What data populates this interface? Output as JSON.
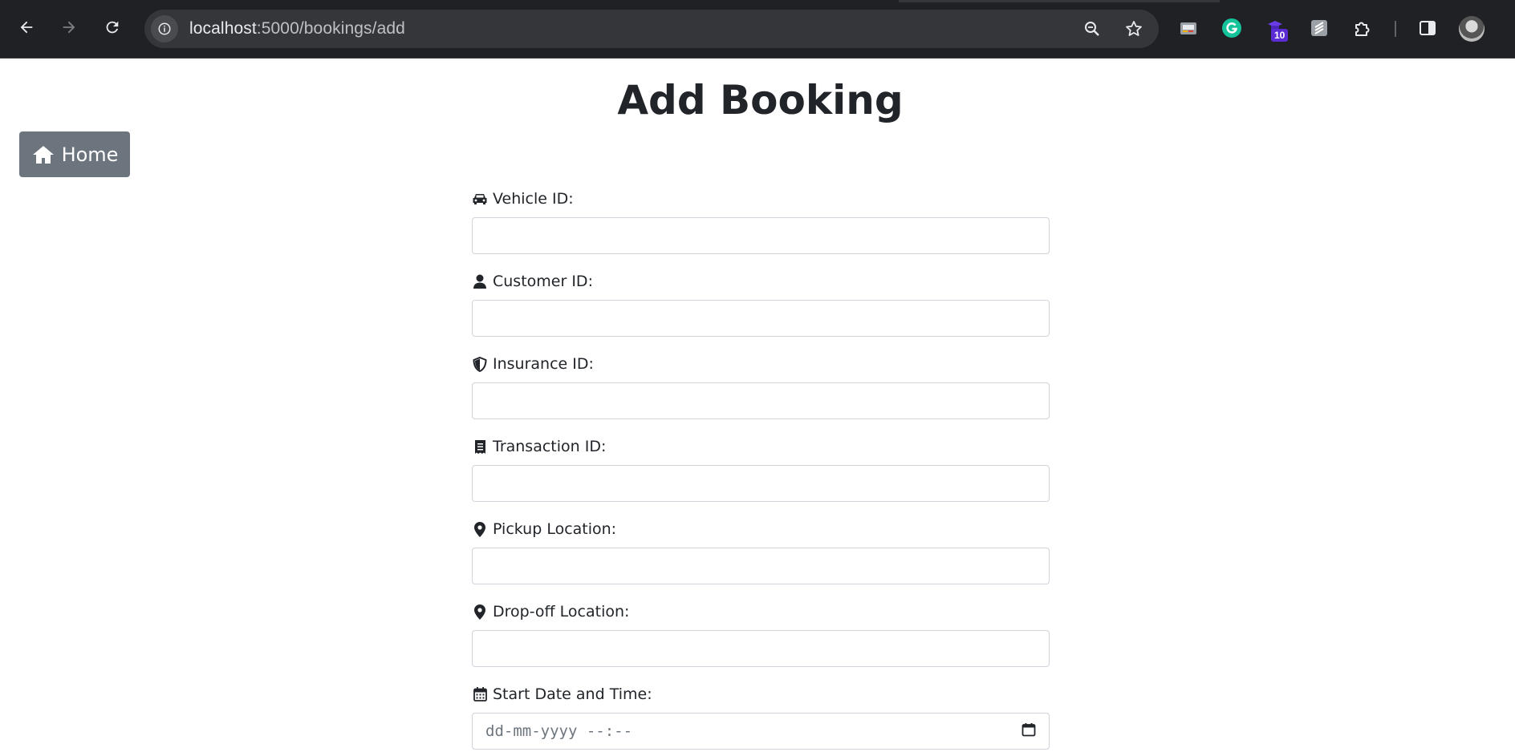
{
  "browser": {
    "url_host": "localhost",
    "url_path": ":5000/bookings/add",
    "extension_badge": "10"
  },
  "page": {
    "title": "Add Booking",
    "home_button": "Home"
  },
  "form": {
    "fields": [
      {
        "label": "Vehicle ID:",
        "icon": "car-icon",
        "value": ""
      },
      {
        "label": "Customer ID:",
        "icon": "user-icon",
        "value": ""
      },
      {
        "label": "Insurance ID:",
        "icon": "shield-icon",
        "value": ""
      },
      {
        "label": "Transaction ID:",
        "icon": "receipt-icon",
        "value": ""
      },
      {
        "label": "Pickup Location:",
        "icon": "map-marker-icon",
        "value": ""
      },
      {
        "label": "Drop-off Location:",
        "icon": "map-marker-icon",
        "value": ""
      },
      {
        "label": "Start Date and Time:",
        "icon": "calendar-icon",
        "placeholder": "dd-mm-yyyy --:--"
      }
    ]
  }
}
